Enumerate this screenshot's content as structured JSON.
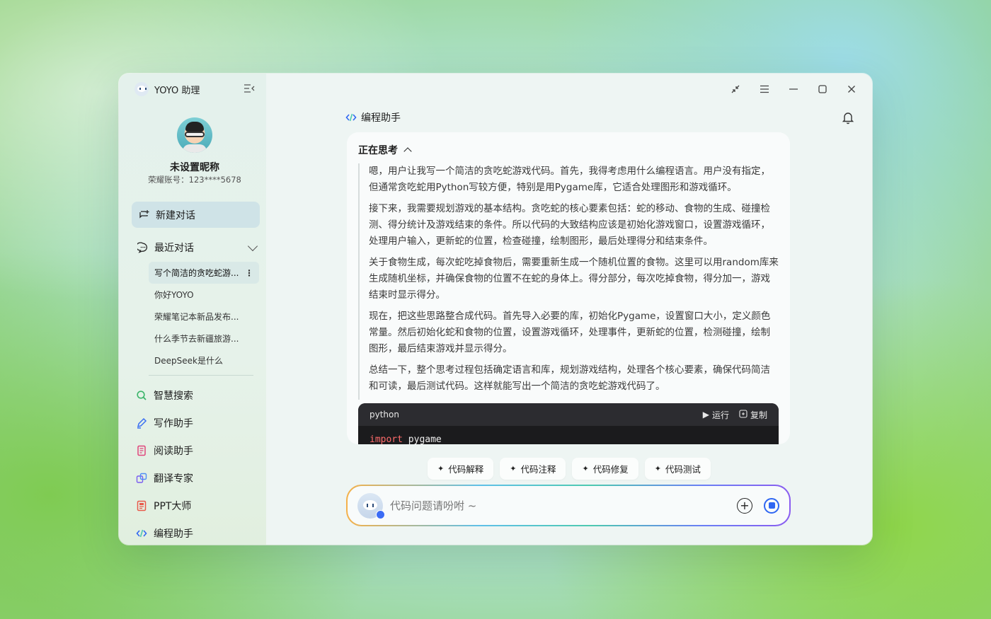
{
  "app": {
    "title": "YOYO 助理"
  },
  "profile": {
    "nickname": "未设置昵称",
    "account": "荣耀账号：123****5678"
  },
  "sidebar": {
    "new_chat": "新建对话",
    "recent": "最近对话",
    "history": [
      {
        "label": "写个简洁的贪吃蛇游...",
        "active": true
      },
      {
        "label": "你好YOYO"
      },
      {
        "label": "荣耀笔记本新品发布..."
      },
      {
        "label": "什么季节去新疆旅游..."
      },
      {
        "label": "DeepSeek是什么"
      }
    ],
    "tools": [
      {
        "label": "智慧搜索",
        "icon": "search-icon",
        "color": "#3bb56a"
      },
      {
        "label": "写作助手",
        "icon": "pen-icon",
        "color": "#3a6ff2"
      },
      {
        "label": "阅读助手",
        "icon": "document-icon",
        "color": "#e0457b"
      },
      {
        "label": "翻译专家",
        "icon": "translate-icon",
        "color": "#7a5cf0"
      },
      {
        "label": "PPT大师",
        "icon": "ppt-icon",
        "color": "#e85a4a"
      },
      {
        "label": "编程助手",
        "icon": "code-icon",
        "color": "#2f66f2"
      }
    ]
  },
  "main": {
    "title": "编程助手",
    "thinking": {
      "label": "正在思考",
      "paragraphs": [
        "嗯，用户让我写一个简洁的贪吃蛇游戏代码。首先，我得考虑用什么编程语言。用户没有指定，但通常贪吃蛇用Python写较方便，特别是用Pygame库，它适合处理图形和游戏循环。",
        "接下来，我需要规划游戏的基本结构。贪吃蛇的核心要素包括：蛇的移动、食物的生成、碰撞检测、得分统计及游戏结束的条件。所以代码的大致结构应该是初始化游戏窗口，设置游戏循环，处理用户输入，更新蛇的位置，检查碰撞，绘制图形，最后处理得分和结束条件。",
        "关于食物生成，每次蛇吃掉食物后，需要重新生成一个随机位置的食物。这里可以用random库来生成随机坐标，并确保食物的位置不在蛇的身体上。得分部分，每次吃掉食物，得分加一，游戏结束时显示得分。",
        "现在，把这些思路整合成代码。首先导入必要的库，初始化Pygame，设置窗口大小，定义颜色常量。然后初始化蛇和食物的位置，设置游戏循环，处理事件，更新蛇的位置，检测碰撞，绘制图形，最后结束游戏并显示得分。",
        "总结一下，整个思考过程包括确定语言和库，规划游戏结构，处理各个核心要素，确保代码简洁和可读，最后测试代码。这样就能写出一个简洁的贪吃蛇游戏代码了。"
      ]
    },
    "code": {
      "language": "python",
      "run": "运行",
      "copy": "复制",
      "keyword": "import",
      "rest": " pygame"
    },
    "chips": [
      "代码解释",
      "代码注释",
      "代码修复",
      "代码测试"
    ],
    "input": {
      "placeholder": "代码问题请吩咐 ~"
    }
  },
  "colors": {
    "accent": "#2f66f2",
    "sidebar_active": "#cfe3e7"
  }
}
